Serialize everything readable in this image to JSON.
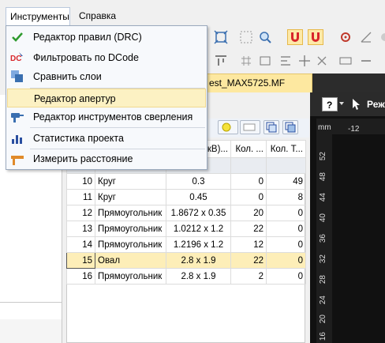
{
  "menubar": {
    "tools": "Инструменты",
    "help": "Справка"
  },
  "dropdown": {
    "items": [
      {
        "label": "Редактор правил (DRC)",
        "icon": "checkmark-icon"
      },
      {
        "label": "Фильтровать по DCode",
        "icon": "dcode-filter-icon"
      },
      {
        "label": "Сравнить слои",
        "icon": "compare-layers-icon"
      },
      {
        "label": "Редактор апертур",
        "icon": "none",
        "highlighted": true
      },
      {
        "label": "Редактор инструментов сверления",
        "icon": "drill-icon"
      },
      {
        "label": "Статистика проекта",
        "icon": "bar-chart-icon"
      },
      {
        "label": "Измерить расстояние",
        "icon": "ruler-icon"
      }
    ]
  },
  "doc_tab": {
    "label": "est_MAX5725.MF"
  },
  "canvas": {
    "mode_label": "Реж",
    "ruler_unit": "mm",
    "ruler_top_label": "-12",
    "ruler_left_labels": [
      "52",
      "48",
      "44",
      "40",
      "36",
      "32",
      "28",
      "24",
      "20",
      "16"
    ]
  },
  "aperture_table": {
    "headers": [
      "",
      "",
      "кВ)...",
      "Кол. ...",
      "Кол. Т..."
    ],
    "rows": [
      {
        "no": "10",
        "shape": "Круг",
        "size": "0.3",
        "count1": "0",
        "count2": "49"
      },
      {
        "no": "11",
        "shape": "Круг",
        "size": "0.45",
        "count1": "0",
        "count2": "8"
      },
      {
        "no": "12",
        "shape": "Прямоугольник",
        "size": "1.8672 x 0.35",
        "count1": "20",
        "count2": "0"
      },
      {
        "no": "13",
        "shape": "Прямоугольник",
        "size": "1.0212 x 1.2",
        "count1": "22",
        "count2": "0"
      },
      {
        "no": "14",
        "shape": "Прямоугольник",
        "size": "1.2196 x 1.2",
        "count1": "12",
        "count2": "0"
      },
      {
        "no": "15",
        "shape": "Овал",
        "size": "2.8 x 1.9",
        "count1": "22",
        "count2": "0",
        "selected": true
      },
      {
        "no": "16",
        "shape": "Прямоугольник",
        "size": "2.8 x 1.9",
        "count1": "2",
        "count2": "0"
      }
    ]
  },
  "colors": {
    "highlight": "#fcf1c3",
    "selected_row": "#fdeeb8",
    "canvas": "#111111"
  }
}
